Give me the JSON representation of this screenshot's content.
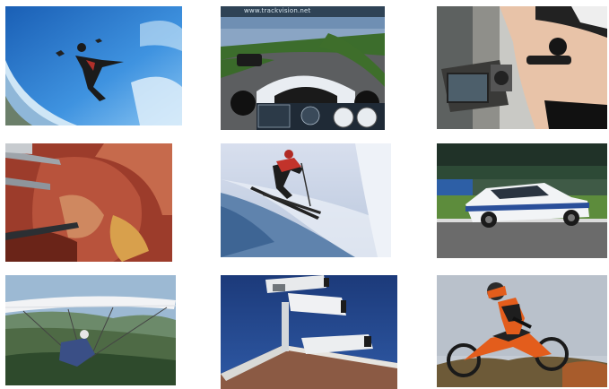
{
  "grid": {
    "background": "#ffffff",
    "tiles": [
      {
        "name": "wingsuit-skydiver-photo",
        "subject": "wingsuit skydiver"
      },
      {
        "name": "race-car-onboard-photo",
        "subject": "race car onboard camera",
        "overlay_text": "www.trackvision.net"
      },
      {
        "name": "camera-operator-photo",
        "subject": "camera operator with headset"
      },
      {
        "name": "surgery-endoscope-photo",
        "subject": "laparoscopic surgery"
      },
      {
        "name": "skier-jump-photo",
        "subject": "skier jumping"
      },
      {
        "name": "sports-car-track-photo",
        "subject": "sports car on race track"
      },
      {
        "name": "hang-glider-photo",
        "subject": "hang glider"
      },
      {
        "name": "security-cameras-photo",
        "subject": "security cameras on wall"
      },
      {
        "name": "motocross-rider-photo",
        "subject": "motocross rider jumping"
      }
    ]
  }
}
